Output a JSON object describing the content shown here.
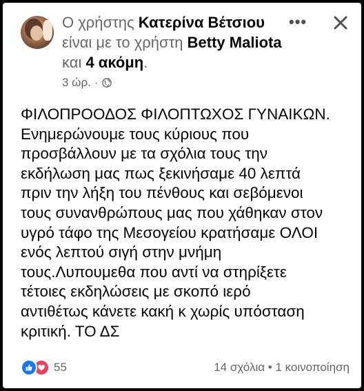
{
  "post": {
    "header": {
      "prefix": "Ο χρήστης ",
      "author": "Κατερίνα Βέτσιου",
      "mid": " είναι με το χρήστη ",
      "tagged": "Betty Maliota",
      "conj": " και ",
      "others": "4 ακόμη",
      "suffix": "."
    },
    "time": "3 ώρ.",
    "separator": "·",
    "body": "ΦΙΛΟΠΡΟΟΔΟΣ ΦΙΛΟΠΤΩΧΟΣ ΓΥΝΑΙΚΩΝ.\nΕνημερώνουμε τους κύριους που\nπροσβάλλουν με τα σχόλια τους την\nεκδήλωση μας πως ξεκινήσαμε 40 λεπτά\nπριν την λήξη του πένθους και σεβόμενοι\nτους συνανθρώπους μας που χάθηκαν στον\nυγρό τάφο της Μεσογείου κρατήσαμε ΟΛΟΙ\nενός λεπτού σιγή στην μνήμη\nτους.Λυπουμεθα που αντί να στηρίξετε\nτέτοιες εκδηλώσεις με σκοπό ιερό\nαντιθέτως κάνετε κακή κ χωρίς υπόσταση\nκριτική.                     ΤΟ ΔΣ"
  },
  "footer": {
    "reaction_count": "55",
    "comments": "14 σχόλια",
    "dot": " • ",
    "shares": "1 κοινοποίηση"
  },
  "icons": {
    "more": "more-options-icon",
    "close": "close-icon",
    "privacy": "globe-icon",
    "like": "like-reaction-icon",
    "love": "love-reaction-icon"
  },
  "colors": {
    "like": "#1877f2",
    "love": "#f33e58",
    "secondary_text": "#65676b",
    "primary_text": "#050505"
  }
}
